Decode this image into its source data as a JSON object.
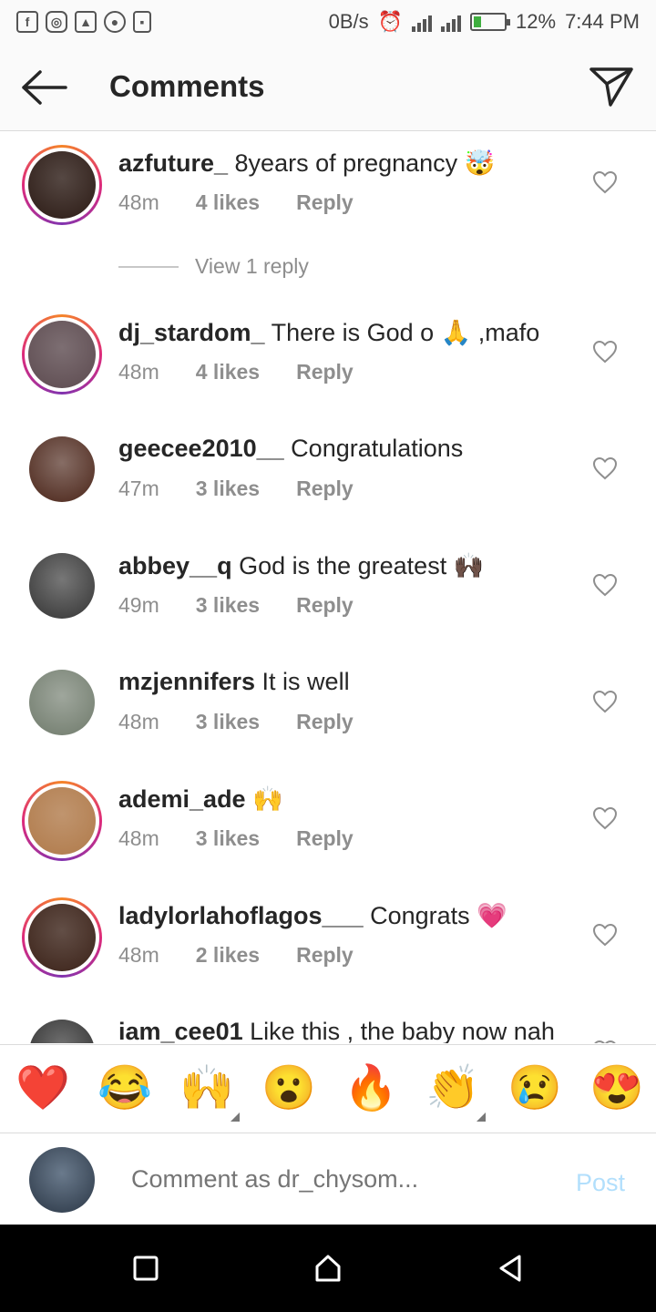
{
  "status": {
    "speed": "0B/s",
    "battery": "12%",
    "time": "7:44 PM",
    "left_icons": [
      "facebook-icon",
      "instagram-icon",
      "gallery-icon",
      "soccer-icon",
      "lock-icon"
    ]
  },
  "header": {
    "title": "Comments"
  },
  "comments": [
    {
      "user": "azfuture_",
      "text": " 8years of pregnancy 🤯",
      "time": "48m",
      "likes": "4 likes",
      "reply": "Reply",
      "story": true,
      "avatar": "#2b1a14"
    },
    {
      "user": "dj_stardom_",
      "text": " There is God o 🙏 ,mafo",
      "time": "48m",
      "likes": "4 likes",
      "reply": "Reply",
      "story": true,
      "avatar": "#5c4a4f"
    },
    {
      "user": "geecee2010__",
      "text": " Congratulations",
      "time": "47m",
      "likes": "3 likes",
      "reply": "Reply",
      "story": false,
      "avatar": "#4a2418"
    },
    {
      "user": "abbey__q",
      "text": " God is the greatest 🙌🏿",
      "time": "49m",
      "likes": "3 likes",
      "reply": "Reply",
      "story": false,
      "avatar": "#333333"
    },
    {
      "user": "mzjennifers",
      "text": " It is well",
      "time": "48m",
      "likes": "3 likes",
      "reply": "Reply",
      "story": false,
      "avatar": "#6f7a6b"
    },
    {
      "user": "ademi_ade",
      "text": " 🙌",
      "time": "48m",
      "likes": "3 likes",
      "reply": "Reply",
      "story": true,
      "avatar": "#b07a4a"
    },
    {
      "user": "ladylorlahoflagos___",
      "text": " Congrats 💗",
      "time": "48m",
      "likes": "2 likes",
      "reply": "Reply",
      "story": true,
      "avatar": "#3b2218"
    },
    {
      "user": "iam_cee01",
      "text": " Like this , the baby now nah",
      "time": "",
      "likes": "",
      "reply": "",
      "story": false,
      "avatar": "#2a2a2a"
    }
  ],
  "view_reply": "View 1 reply",
  "emoji_bar": [
    "❤️",
    "😂",
    "🙌",
    "😮",
    "🔥",
    "👏",
    "😢",
    "😍"
  ],
  "compose": {
    "placeholder": "Comment as dr_chysom...",
    "post": "Post"
  },
  "colors": {
    "link_blue": "#b2dffc",
    "meta_gray": "#8e8e8e",
    "story_ring": "#dd2a7b"
  }
}
